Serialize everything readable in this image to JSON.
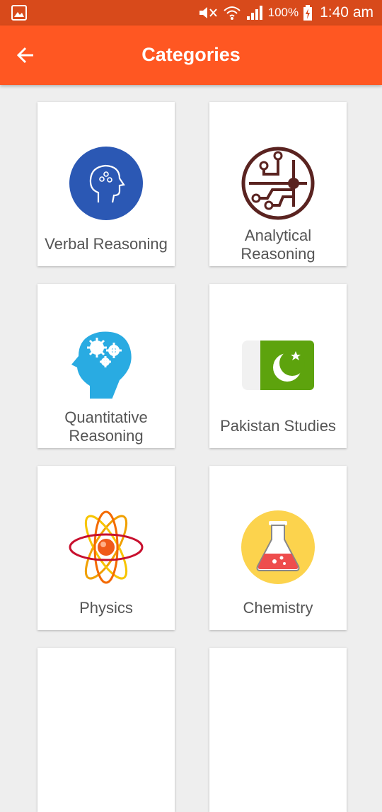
{
  "status_bar": {
    "battery_percent": "100%",
    "time": "1:40 am",
    "icons": [
      "gallery-icon",
      "mute-icon",
      "wifi-icon",
      "signal-icon",
      "battery-charging-icon"
    ]
  },
  "app_bar": {
    "title": "Categories",
    "back_icon": "arrow-left-icon"
  },
  "colors": {
    "app_bar": "#ff5722",
    "status_bar": "#d84a1b"
  },
  "categories": [
    {
      "label": "Verbal Reasoning",
      "icon": "head-brain-icon"
    },
    {
      "label": "Analytical Reasoning",
      "icon": "circuit-icon"
    },
    {
      "label": "Quantitative Reasoning",
      "icon": "head-gears-icon"
    },
    {
      "label": "Pakistan Studies",
      "icon": "pakistan-flag-icon"
    },
    {
      "label": "Physics",
      "icon": "atom-icon"
    },
    {
      "label": "Chemistry",
      "icon": "flask-icon"
    }
  ]
}
